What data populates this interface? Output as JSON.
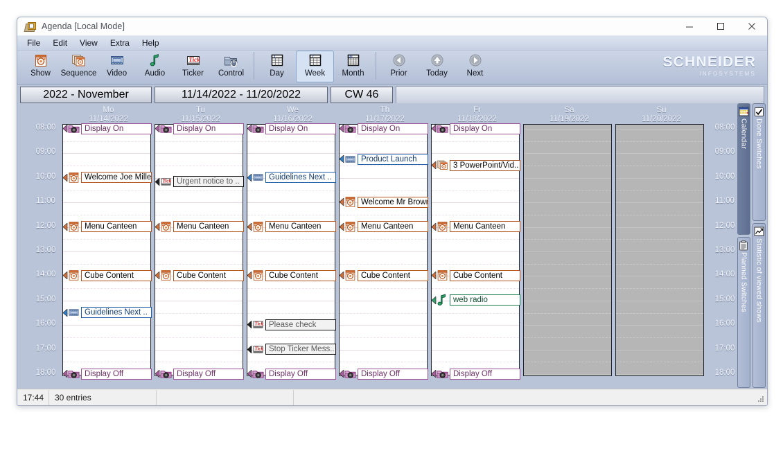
{
  "window": {
    "title": "Agenda [Local Mode]",
    "icon": "agenda-app-icon",
    "minimize": "minimize-icon",
    "maximize": "maximize-icon",
    "close": "close-icon"
  },
  "menu": [
    {
      "label": "File"
    },
    {
      "label": "Edit"
    },
    {
      "label": "View"
    },
    {
      "label": "Extra"
    },
    {
      "label": "Help"
    }
  ],
  "toolbar": {
    "buttons": [
      {
        "label": "Show",
        "icon": "show-icon",
        "selected": false
      },
      {
        "label": "Sequence",
        "icon": "sequence-icon",
        "selected": false
      },
      {
        "label": "Video",
        "icon": "video-icon",
        "selected": false
      },
      {
        "label": "Audio",
        "icon": "audio-icon",
        "selected": false
      },
      {
        "label": "Ticker",
        "icon": "ticker-icon",
        "selected": false
      },
      {
        "label": "Control",
        "icon": "control-icon",
        "selected": false
      },
      {
        "label": "Day",
        "icon": "day-calendar-icon",
        "selected": false
      },
      {
        "label": "Week",
        "icon": "week-calendar-icon",
        "selected": true
      },
      {
        "label": "Month",
        "icon": "month-calendar-icon",
        "selected": false
      },
      {
        "label": "Prior",
        "icon": "arrow-left-icon",
        "selected": false
      },
      {
        "label": "Today",
        "icon": "arrow-up-icon",
        "selected": false
      },
      {
        "label": "Next",
        "icon": "arrow-right-icon",
        "selected": false
      }
    ],
    "logo_main": "SCHNEIDER",
    "logo_sub": "INFOSYSTEMS"
  },
  "datebar": {
    "month": "2022 - November",
    "range": "11/14/2022 - 11/20/2022",
    "week": "CW 46"
  },
  "days": [
    {
      "name": "Mo",
      "date": "11/14/2022",
      "weekend": false
    },
    {
      "name": "Tu",
      "date": "11/15/2022",
      "weekend": false
    },
    {
      "name": "We",
      "date": "11/16/2022",
      "weekend": false
    },
    {
      "name": "Th",
      "date": "11/17/2022",
      "weekend": false
    },
    {
      "name": "Fr",
      "date": "11/18/2022",
      "weekend": false
    },
    {
      "name": "Sa",
      "date": "11/19/2022",
      "weekend": true
    },
    {
      "name": "Su",
      "date": "11/20/2022",
      "weekend": true
    }
  ],
  "times": [
    "08:00",
    "09:00",
    "10:00",
    "11:00",
    "12:00",
    "13:00",
    "14:00",
    "15:00",
    "16:00",
    "17:00",
    "18:00"
  ],
  "entries": [
    {
      "day": 0,
      "time": "08:00",
      "label": "Display On",
      "kind": "display",
      "icon": "display-on-icon",
      "w": 128
    },
    {
      "day": 0,
      "time": "10:00",
      "label": "Welcome Joe Miller",
      "kind": "show",
      "icon": "show-icon",
      "w": 128
    },
    {
      "day": 0,
      "time": "12:00",
      "label": "Menu Canteen",
      "kind": "show",
      "icon": "show-icon",
      "w": 128
    },
    {
      "day": 0,
      "time": "14:00",
      "label": "Cube Content",
      "kind": "show",
      "icon": "show-icon",
      "w": 128
    },
    {
      "day": 0,
      "time": "15:30",
      "label": "Guidelines Next ..",
      "kind": "video",
      "icon": "video-icon",
      "w": 128
    },
    {
      "day": 0,
      "time": "18:00",
      "label": "Display Off",
      "kind": "display",
      "icon": "display-off-icon",
      "w": 128
    },
    {
      "day": 1,
      "time": "08:00",
      "label": "Display On",
      "kind": "display",
      "icon": "display-on-icon",
      "w": 128
    },
    {
      "day": 1,
      "time": "10:10",
      "label": "Urgent notice to ..",
      "kind": "ticker",
      "icon": "ticker-icon",
      "w": 128
    },
    {
      "day": 1,
      "time": "12:00",
      "label": "Menu Canteen",
      "kind": "show",
      "icon": "show-icon",
      "w": 128
    },
    {
      "day": 1,
      "time": "14:00",
      "label": "Cube Content",
      "kind": "show",
      "icon": "show-icon",
      "w": 128
    },
    {
      "day": 1,
      "time": "18:00",
      "label": "Display Off",
      "kind": "display",
      "icon": "display-off-icon",
      "w": 128
    },
    {
      "day": 2,
      "time": "08:00",
      "label": "Display On",
      "kind": "display",
      "icon": "display-on-icon",
      "w": 128
    },
    {
      "day": 2,
      "time": "10:00",
      "label": "Guidelines Next ..",
      "kind": "video",
      "icon": "video-icon",
      "w": 128
    },
    {
      "day": 2,
      "time": "12:00",
      "label": "Menu Canteen",
      "kind": "show",
      "icon": "show-icon",
      "w": 128
    },
    {
      "day": 2,
      "time": "14:00",
      "label": "Cube Content",
      "kind": "show",
      "icon": "show-icon",
      "w": 128
    },
    {
      "day": 2,
      "time": "16:00",
      "label": "Please check",
      "kind": "ticker",
      "icon": "ticker-icon",
      "w": 128
    },
    {
      "day": 2,
      "time": "17:00",
      "label": "Stop Ticker Mess..",
      "kind": "ticker",
      "icon": "ticker-icon",
      "w": 128
    },
    {
      "day": 2,
      "time": "18:00",
      "label": "Display Off",
      "kind": "display",
      "icon": "display-off-icon",
      "w": 128
    },
    {
      "day": 3,
      "time": "08:00",
      "label": "Display On",
      "kind": "display",
      "icon": "display-on-icon",
      "w": 128
    },
    {
      "day": 3,
      "time": "09:15",
      "label": "Product Launch",
      "kind": "video",
      "icon": "video-icon",
      "w": 128
    },
    {
      "day": 3,
      "time": "11:00",
      "label": "Welcome Mr Brown",
      "kind": "show",
      "icon": "show-icon",
      "w": 128
    },
    {
      "day": 3,
      "time": "12:00",
      "label": "Menu Canteen",
      "kind": "show",
      "icon": "show-icon",
      "w": 128
    },
    {
      "day": 3,
      "time": "14:00",
      "label": "Cube Content",
      "kind": "show",
      "icon": "show-icon",
      "w": 128
    },
    {
      "day": 3,
      "time": "18:00",
      "label": "Display Off",
      "kind": "display",
      "icon": "display-off-icon",
      "w": 128
    },
    {
      "day": 4,
      "time": "08:00",
      "label": "Display On",
      "kind": "display",
      "icon": "display-on-icon",
      "w": 128
    },
    {
      "day": 4,
      "time": "09:30",
      "label": "3 PowerPoint/Vid..",
      "kind": "seq",
      "icon": "sequence-icon",
      "w": 128
    },
    {
      "day": 4,
      "time": "12:00",
      "label": "Menu Canteen",
      "kind": "show",
      "icon": "show-icon",
      "w": 128
    },
    {
      "day": 4,
      "time": "14:00",
      "label": "Cube Content",
      "kind": "show",
      "icon": "show-icon",
      "w": 128
    },
    {
      "day": 4,
      "time": "15:00",
      "label": "web radio",
      "kind": "audio",
      "icon": "audio-icon",
      "w": 128
    },
    {
      "day": 4,
      "time": "18:00",
      "label": "Display Off",
      "kind": "display",
      "icon": "display-off-icon",
      "w": 128
    }
  ],
  "side_tabs_inner": [
    {
      "label": "Calendar",
      "icon": "calendar-icon",
      "selected": true
    },
    {
      "label": "Planned Switches",
      "icon": "clipboard-icon",
      "selected": false
    }
  ],
  "side_tabs_outer": [
    {
      "label": "Done Switches",
      "icon": "checkbox-icon",
      "selected": false
    },
    {
      "label": "Statistic of viewed shows",
      "icon": "chart-icon",
      "selected": false
    }
  ],
  "statusbar": {
    "time": "17:44",
    "entries": "30 entries",
    "cell3": "",
    "cell4": ""
  }
}
